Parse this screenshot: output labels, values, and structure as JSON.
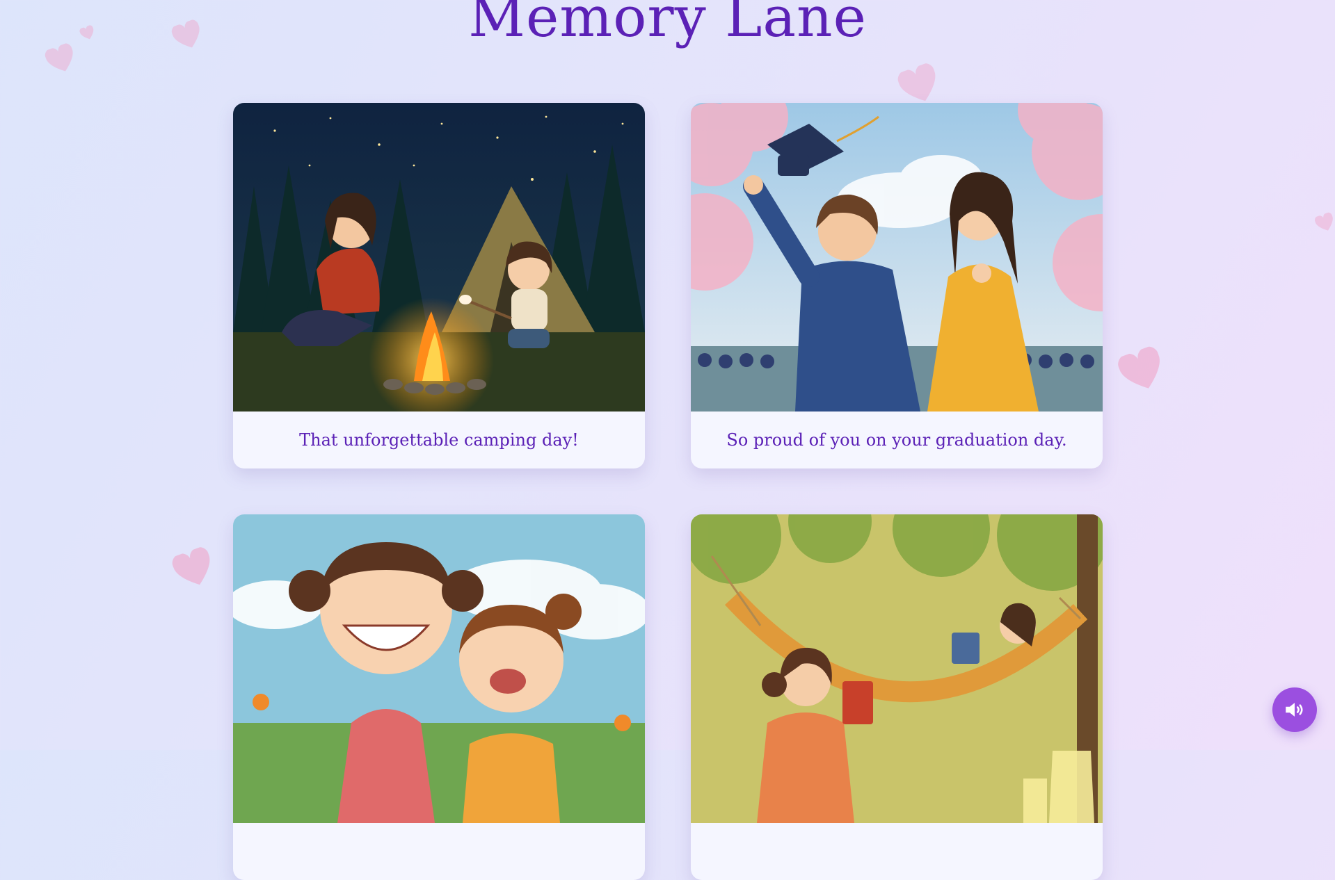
{
  "title": "Memory Lane",
  "colors": {
    "accent": "#5b21b6",
    "button": "#9b4fe0",
    "heart": "#f0a4c9"
  },
  "cards": [
    {
      "caption": "That unforgettable camping day!",
      "image": "campfire-night-illustration"
    },
    {
      "caption": "So proud of you on your graduation day.",
      "image": "graduation-celebration-illustration"
    },
    {
      "caption": "",
      "image": "silly-faces-meadow-illustration"
    },
    {
      "caption": "",
      "image": "hammock-reading-illustration"
    }
  ],
  "sound_button": {
    "icon": "speaker-icon"
  }
}
